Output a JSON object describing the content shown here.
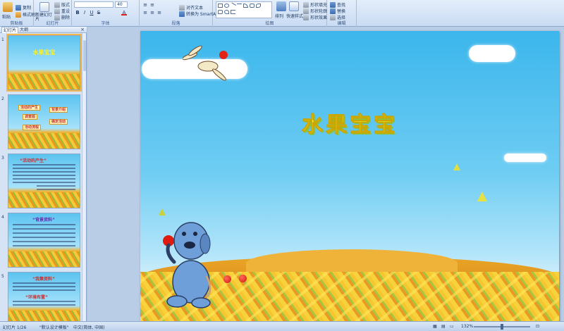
{
  "ribbon": {
    "groups": [
      {
        "name": "剪贴板",
        "buttons": [
          "粘贴",
          "复制",
          "格式刷"
        ]
      },
      {
        "name": "幻灯片",
        "buttons": [
          "新建幻灯片",
          "版式",
          "重设",
          "删除"
        ]
      },
      {
        "name": "字体",
        "font_size": "40"
      },
      {
        "name": "段落",
        "buttons": [
          "对齐文本",
          "转换为 SmartArt"
        ]
      },
      {
        "name": "绘图",
        "buttons": [
          "排列",
          "快速样式",
          "形状填充",
          "形状轮廓",
          "形状效果"
        ]
      },
      {
        "name": "编辑",
        "buttons": [
          "查找",
          "替换",
          "选择"
        ]
      }
    ]
  },
  "left_pane": {
    "tabs": [
      "幻灯片",
      "大纲"
    ],
    "close_glyph": "×",
    "slides": [
      {
        "number": "1",
        "title": "水果宝宝",
        "selected": true
      },
      {
        "number": "2",
        "items": [
          "活动的产生",
          "背景介绍",
          "调查图",
          "确定活动",
          "活动流程"
        ]
      },
      {
        "number": "3",
        "heading": "“活动的产生”"
      },
      {
        "number": "4",
        "heading": "“背景资料”"
      },
      {
        "number": "5",
        "heading": "“我集资料”",
        "subheading": "“环境布置”"
      }
    ]
  },
  "slide": {
    "title": "水果宝宝"
  },
  "status_bar": {
    "slide_position": "幻灯片 1/26",
    "theme": "\"默认设计模板\"",
    "language": "中文(简体, 中国)",
    "zoom": "132%"
  },
  "colors": {
    "ribbon_bg": "#dbe7f8",
    "selection_border": "#f5b64a",
    "sky": "#3bb6ec",
    "title_yellow": "#f2f233"
  }
}
